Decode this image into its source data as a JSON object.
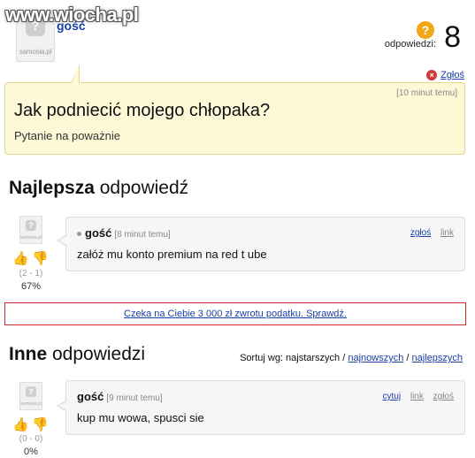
{
  "watermark": "www.wiocha.pl",
  "top": {
    "author": "gość",
    "avatar_brand": "samosia.pl",
    "avatar_glyph": "?",
    "answers_label": "odpowiedzi:",
    "answers_count": "8",
    "badge_glyph": "?",
    "report_label": "Zgłoś"
  },
  "question": {
    "time": "[10 minut temu]",
    "title": "Jak podniecić mojego chłopaka?",
    "subtitle": "Pytanie na poważnie"
  },
  "best": {
    "title_bold": "Najlepsza",
    "title_rest": " odpowiedź",
    "answer": {
      "author": "gość",
      "time": "[8 minut temu]",
      "text": "załóż mu konto premium na red t ube",
      "actions": [
        "zgłoś",
        "link"
      ],
      "votes": "(2 - 1)",
      "percent": "67%",
      "avatar_brand": "samosia.pl",
      "avatar_glyph": "?"
    }
  },
  "ad": {
    "text": "Czeka na Ciebie 3 000 zł zwrotu podatku. Sprawdź."
  },
  "other": {
    "title_bold": "Inne",
    "title_rest": " odpowiedzi",
    "sort_label": "Sortuj wg: najstarszych /",
    "sort_newest": "najnowszych",
    "sort_sep": " / ",
    "sort_best": "najlepszych",
    "answer": {
      "author": "gość",
      "time": "[9 minut temu]",
      "text": "kup mu wowa, spusci sie",
      "actions": [
        "cytuj",
        "link",
        "zgłoś"
      ],
      "votes": "(0 - 0)",
      "percent": "0%",
      "avatar_brand": "samosia.pl",
      "avatar_glyph": "?"
    }
  },
  "icons": {
    "thumb_up": "👍",
    "thumb_down": "👎",
    "close": "×"
  },
  "colors": {
    "link": "#1a3ea8",
    "question_bg": "#fdf9d6",
    "badge": "#f0a616",
    "report_icon": "#d23a3a",
    "ad_border": "#cc2a2a"
  }
}
